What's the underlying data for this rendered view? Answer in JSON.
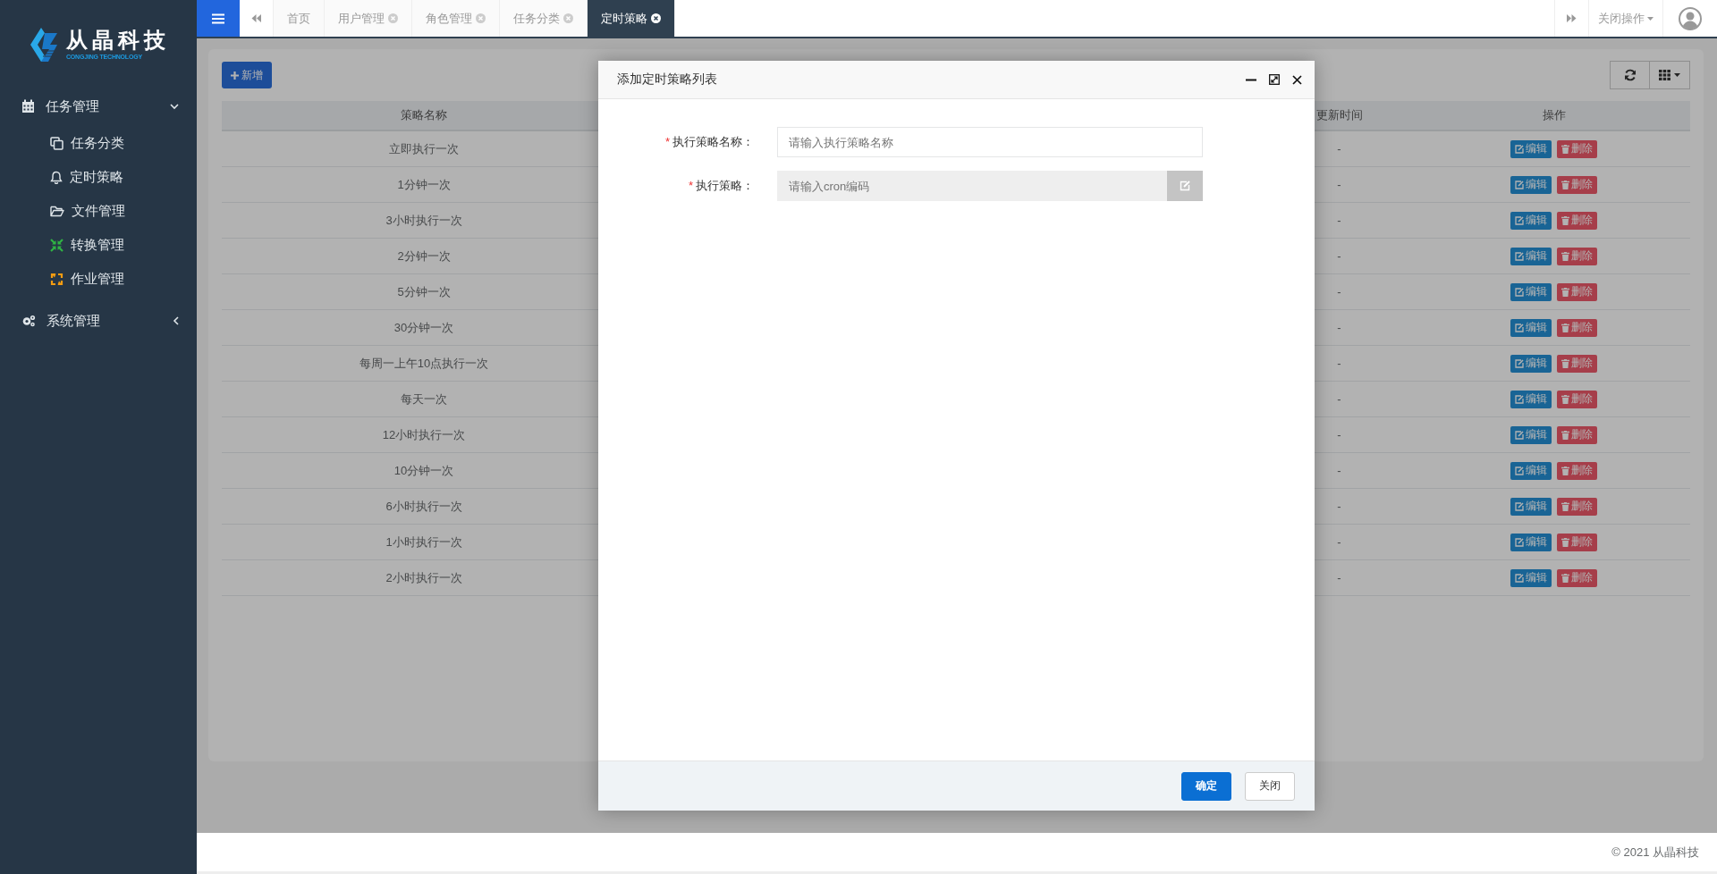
{
  "sidebar": {
    "logo": {
      "name": "从晶科技",
      "subtitle": "CONGJING TECHNOLOGY"
    },
    "groups": [
      {
        "label": "任务管理",
        "expanded": true,
        "children": [
          {
            "label": "任务分类"
          },
          {
            "label": "定时策略"
          },
          {
            "label": "文件管理"
          },
          {
            "label": "转换管理"
          },
          {
            "label": "作业管理"
          }
        ]
      },
      {
        "label": "系统管理",
        "expanded": false
      }
    ]
  },
  "topbar": {
    "tabs": [
      {
        "label": "首页",
        "kind": "home",
        "selected": false
      },
      {
        "label": "用户管理",
        "kind": "page",
        "selected": false
      },
      {
        "label": "角色管理",
        "kind": "page",
        "selected": false
      },
      {
        "label": "任务分类",
        "kind": "page",
        "selected": false
      },
      {
        "label": "定时策略",
        "kind": "page",
        "selected": true
      }
    ],
    "close_menu": "关闭操作"
  },
  "toolbar": {
    "add_button": "新增"
  },
  "table": {
    "columns": [
      "策略名称",
      "更新时间",
      "操作"
    ],
    "rows": [
      {
        "name": "立即执行一次",
        "updated": "-",
        "actions": [
          "编辑",
          "删除"
        ]
      },
      {
        "name": "1分钟一次",
        "updated": "-",
        "actions": [
          "编辑",
          "删除"
        ]
      },
      {
        "name": "3小时执行一次",
        "updated": "-",
        "actions": [
          "编辑",
          "删除"
        ]
      },
      {
        "name": "2分钟一次",
        "updated": "-",
        "actions": [
          "编辑",
          "删除"
        ]
      },
      {
        "name": "5分钟一次",
        "updated": "-",
        "actions": [
          "编辑",
          "删除"
        ]
      },
      {
        "name": "30分钟一次",
        "updated": "-",
        "actions": [
          "编辑",
          "删除"
        ]
      },
      {
        "name": "每周一上午10点执行一次",
        "updated": "-",
        "actions": [
          "编辑",
          "删除"
        ]
      },
      {
        "name": "每天一次",
        "updated": "-",
        "actions": [
          "编辑",
          "删除"
        ]
      },
      {
        "name": "12小时执行一次",
        "updated": "-",
        "actions": [
          "编辑",
          "删除"
        ]
      },
      {
        "name": "10分钟一次",
        "updated": "-",
        "actions": [
          "编辑",
          "删除"
        ]
      },
      {
        "name": "6小时执行一次",
        "updated": "-",
        "actions": [
          "编辑",
          "删除"
        ]
      },
      {
        "name": "1小时执行一次",
        "updated": "-",
        "actions": [
          "编辑",
          "删除"
        ]
      },
      {
        "name": "2小时执行一次",
        "updated": "-",
        "actions": [
          "编辑",
          "删除"
        ]
      }
    ]
  },
  "modal": {
    "title": "添加定时策略列表",
    "fields": [
      {
        "required_mark": "*",
        "label": "执行策略名称：",
        "placeholder": "请输入执行策略名称",
        "kind": "text"
      },
      {
        "required_mark": "*",
        "label": "执行策略：",
        "placeholder": "请输入cron编码",
        "kind": "picker"
      }
    ],
    "buttons": [
      {
        "label": "确定",
        "kind": "primary"
      },
      {
        "label": "关闭",
        "kind": "default"
      }
    ]
  },
  "footer": {
    "copyright": "© 2021 从晶科技"
  }
}
